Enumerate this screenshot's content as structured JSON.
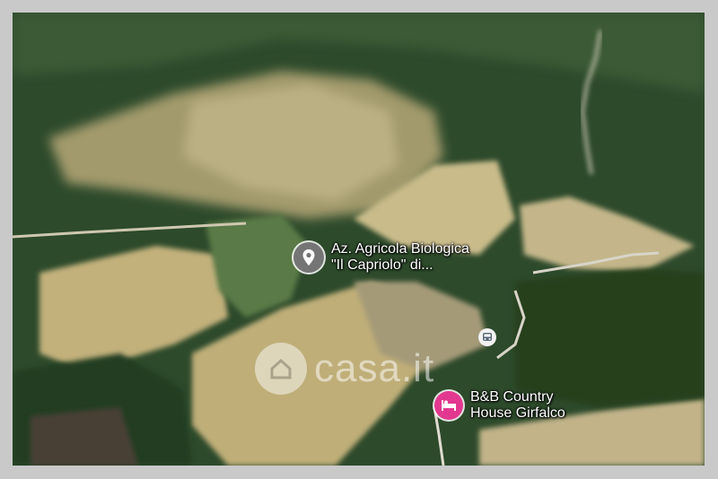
{
  "map": {
    "view": "satellite-3d",
    "colors": {
      "forest": "#2c4a2a",
      "field": "#b9a872",
      "road": "#dcd6c8"
    }
  },
  "places": [
    {
      "label_line1": "Az. Agricola Biologica",
      "label_line2": "\"Il Capriolo\" di...",
      "icon": "location-pin-icon",
      "color": "#757575"
    },
    {
      "label_line1": "B&B Country",
      "label_line2": "House Girfalco",
      "icon": "bed-icon",
      "color": "#e2388f"
    }
  ],
  "transit": {
    "icon": "bus-icon"
  },
  "watermark": {
    "text": "casa.it",
    "icon": "house-icon"
  }
}
